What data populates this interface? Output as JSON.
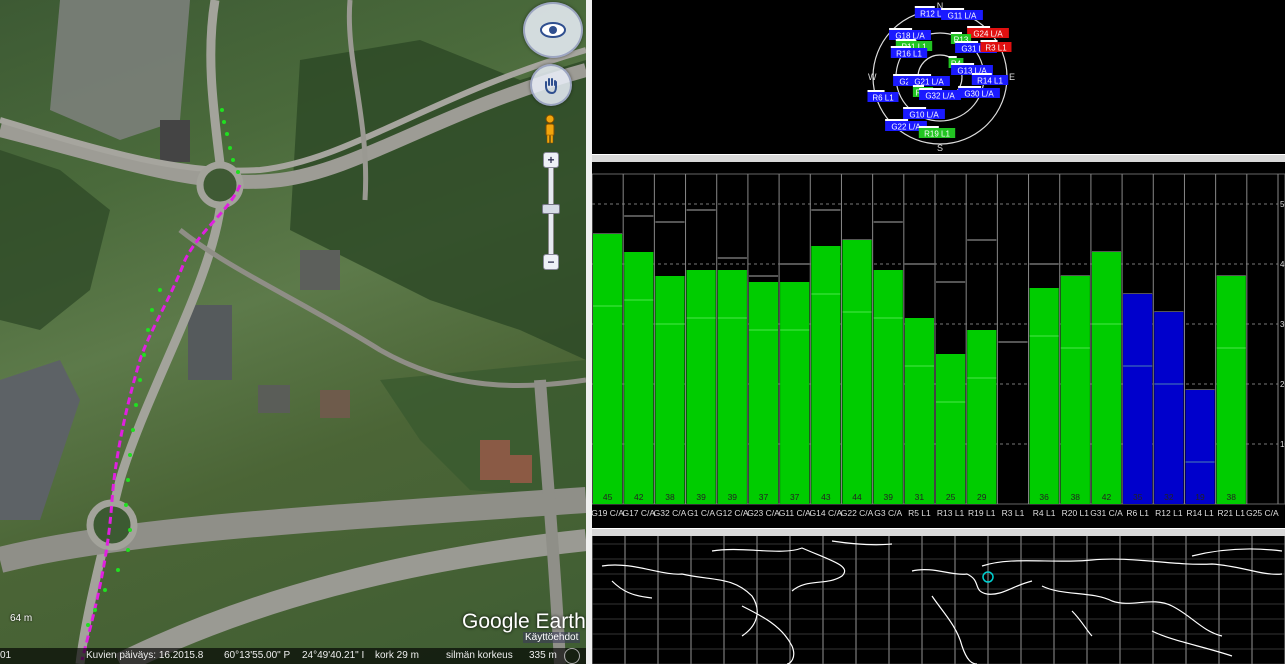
{
  "map": {
    "google_earth_logo": "Google Earth",
    "options_link": "Käyttöehdot",
    "scale_label": "64 m",
    "icons": {
      "look": "eye-icon",
      "move": "hand-icon",
      "street_view": "pegman-icon",
      "zoom_in": "+",
      "zoom_out": "−"
    }
  },
  "status": {
    "left_edge": "01",
    "image_date": "Kuvien päiväys: 16.2015.8",
    "latitude": "60°13'55.00\" P",
    "longitude": "24°49'40.21\" I",
    "elevation": "kork   29 m",
    "eye_alt_label": "silmän korkeus",
    "eye_alt": "335 m"
  },
  "skyplot": {
    "compass": {
      "n": "N",
      "s": "S",
      "e": "E",
      "w": "W"
    },
    "satellites": [
      {
        "label": "R12 L1",
        "color": "#1a1aff"
      },
      {
        "label": "G11 L/A",
        "color": "#1a1aff"
      },
      {
        "label": "G18 L/A",
        "color": "#1a1aff"
      },
      {
        "label": "R11 L1",
        "color": "#22c422"
      },
      {
        "label": "R16 L1",
        "color": "#1a1aff"
      },
      {
        "label": "G24 L/A",
        "color": "#e01010"
      },
      {
        "label": "R13",
        "color": "#22c422"
      },
      {
        "label": "G31 L/A",
        "color": "#1a1aff"
      },
      {
        "label": "R3 L1",
        "color": "#e01010"
      },
      {
        "label": "R4",
        "color": "#22c422"
      },
      {
        "label": "G13 L/A",
        "color": "#1a1aff"
      },
      {
        "label": "R14 L1",
        "color": "#1a1aff"
      },
      {
        "label": "G20 L/A",
        "color": "#1a1aff"
      },
      {
        "label": "G21 L/A",
        "color": "#1a1aff"
      },
      {
        "label": "R20",
        "color": "#22c422"
      },
      {
        "label": "G32 L/A",
        "color": "#1a1aff"
      },
      {
        "label": "G30 L/A",
        "color": "#1a1aff"
      },
      {
        "label": "R6 L1",
        "color": "#1a1aff"
      },
      {
        "label": "G10 L/A",
        "color": "#1a1aff"
      },
      {
        "label": "G22 L/A",
        "color": "#1a1aff"
      },
      {
        "label": "R19 L1",
        "color": "#22c422"
      }
    ]
  },
  "chart_data": {
    "type": "bar",
    "title": "",
    "ylim": [
      0,
      55
    ],
    "y_tick_labels": [
      "10",
      "20",
      "30",
      "40",
      "50"
    ],
    "categories": [
      "G19 C/A",
      "G17 C/A",
      "G32 C/A",
      "G1 C/A",
      "G12 C/A",
      "G23 C/A",
      "G11 C/A",
      "G14 C/A",
      "G22 C/A",
      "G3 C/A",
      "R5 L1",
      "R13 L1",
      "R19 L1",
      "R3 L1",
      "R4 L1",
      "R20 L1",
      "G31 C/A",
      "R6 L1",
      "R12 L1",
      "R14 L1",
      "R21 L1",
      "G25 C/A"
    ],
    "values": [
      45,
      42,
      38,
      39,
      39,
      37,
      37,
      43,
      44,
      39,
      31,
      25,
      29,
      0,
      36,
      38,
      42,
      35,
      32,
      19,
      38,
      0
    ],
    "value_labels": [
      "45",
      "42",
      "38",
      "39",
      "39",
      "37",
      "37",
      "43",
      "44",
      "39",
      "31",
      "25",
      "29",
      "",
      "36",
      "38",
      "42",
      "35",
      "32",
      "19",
      "38",
      ""
    ],
    "outline_top": [
      45,
      48,
      47,
      49,
      41,
      38,
      40,
      49,
      44,
      47,
      40,
      37,
      44,
      27,
      40,
      38,
      42,
      35,
      32,
      19,
      38,
      0
    ],
    "bar_colors": [
      "#00cc00",
      "#00cc00",
      "#00cc00",
      "#00cc00",
      "#00cc00",
      "#00cc00",
      "#00cc00",
      "#00cc00",
      "#00cc00",
      "#00cc00",
      "#00cc00",
      "#00cc00",
      "#00cc00",
      "#00cc00",
      "#00cc00",
      "#00cc00",
      "#00cc00",
      "#0000cc",
      "#0000cc",
      "#0000cc",
      "#00cc00",
      "#00cc00"
    ],
    "grid": true
  }
}
